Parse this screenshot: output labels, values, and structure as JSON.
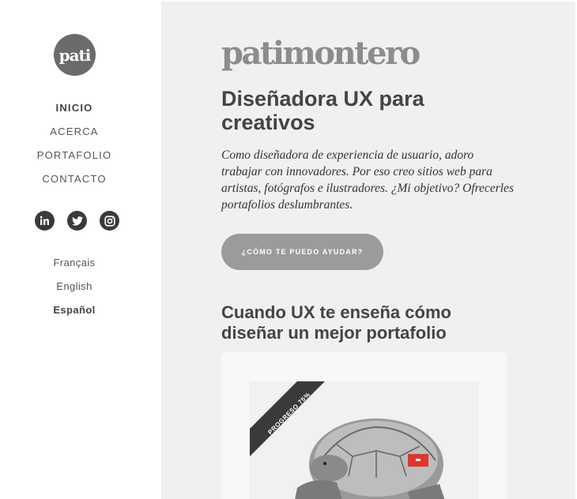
{
  "logo": {
    "text": "pati"
  },
  "nav": {
    "items": [
      {
        "label": "INICIO",
        "active": true
      },
      {
        "label": "ACERCA",
        "active": false
      },
      {
        "label": "PORTAFOLIO",
        "active": false
      },
      {
        "label": "CONTACTO",
        "active": false
      }
    ]
  },
  "social": {
    "icons": [
      "linkedin-icon",
      "twitter-icon",
      "instagram-icon"
    ]
  },
  "languages": {
    "items": [
      {
        "label": "Français",
        "active": false
      },
      {
        "label": "English",
        "active": false
      },
      {
        "label": "Español",
        "active": true
      }
    ]
  },
  "main": {
    "brand": "patimontero",
    "headline": "Diseñadora UX para creativos",
    "intro": "Como diseñadora de experiencia de usuario, adoro trabajar con innovadores. Por eso creo sitios web para artistas, fotógrafos e ilustradores. ¿Mi objetivo? Ofrecerles portafolios deslumbrantes.",
    "cta": "¿CÓMO TE PUEDO AYUDAR?",
    "subheading": "Cuando UX te enseña cómo diseñar un mejor portafolio",
    "card": {
      "ribbon": "PROGRESO 75%"
    }
  },
  "colors": {
    "main_bg": "#f0f0f0",
    "cta_bg": "#9b9b9b",
    "logo_bg": "#6b6b6b",
    "accent_red": "#e2342b"
  }
}
